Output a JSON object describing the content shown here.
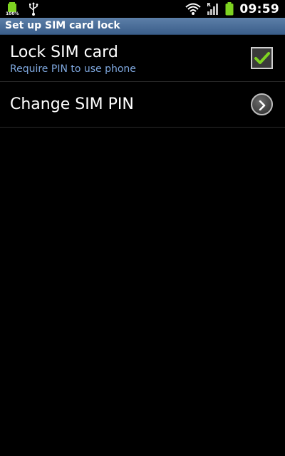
{
  "status_bar": {
    "left_icons": [
      "battery-full-notification-icon",
      "usb-icon"
    ],
    "battery_notification_text": "100%",
    "right_icons": [
      "wifi-icon",
      "signal-icon",
      "battery-icon"
    ],
    "signal_label": "R",
    "time": "09:59"
  },
  "header": {
    "title": "Set up SIM card lock"
  },
  "settings": [
    {
      "title": "Lock SIM card",
      "subtitle": "Require PIN to use phone",
      "control": "checkbox",
      "checked": true
    },
    {
      "title": "Change SIM PIN",
      "control": "chevron"
    }
  ],
  "colors": {
    "background": "#000000",
    "title_bar": "#4a6d97",
    "subtitle": "#7fa8df",
    "check": "#7ed321"
  }
}
